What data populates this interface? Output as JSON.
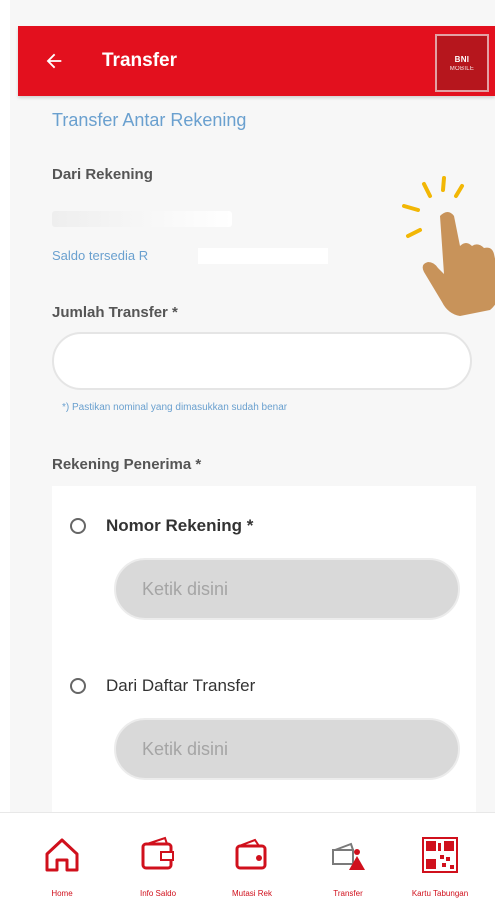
{
  "header": {
    "title": "Transfer",
    "brand_top": "BNI",
    "brand_sub": "MOBILE"
  },
  "form": {
    "section_title": "Transfer Antar Rekening",
    "from_label": "Dari Rekening",
    "balance_label": "Saldo tersedia R",
    "amount_label": "Jumlah Transfer *",
    "amount_value": "",
    "amount_hint": "*) Pastikan nominal yang dimasukkan sudah benar",
    "recipient_label": "Rekening Penerima *",
    "option_account": "Nomor Rekening *",
    "option_account_placeholder": "Ketik disini",
    "option_list": "Dari Daftar Transfer",
    "option_list_placeholder": "Ketik disini"
  },
  "nav": [
    {
      "label": "Home",
      "icon": "home-icon"
    },
    {
      "label": "Info Saldo",
      "icon": "wallet-icon"
    },
    {
      "label": "Mutasi Rek",
      "icon": "wallet-card-icon"
    },
    {
      "label": "Transfer",
      "icon": "transfer-icon"
    },
    {
      "label": "Kartu Tabungan",
      "icon": "qr-code-icon"
    }
  ],
  "colors": {
    "primary": "#e3101e",
    "link": "#6aa0cf"
  }
}
